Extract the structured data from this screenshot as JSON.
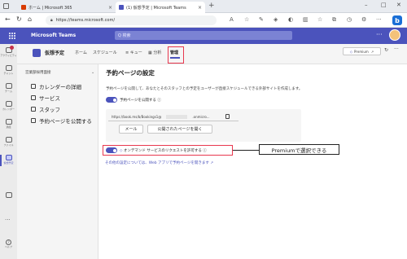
{
  "browser": {
    "tabs": [
      {
        "label": "ホーム | Microsoft 365"
      },
      {
        "label": "(1) 仮想予定 | Microsoft Teams"
      }
    ],
    "url": "https://teams.microsoft.com/",
    "window_controls": {
      "minimize": "–",
      "maximize": "□",
      "close": "✕"
    },
    "profile_initial": "b"
  },
  "teams": {
    "app_name": "Microsoft Teams",
    "search_placeholder": "Q 検索",
    "more": "···"
  },
  "rail": {
    "items": [
      {
        "label": "アクティビティ"
      },
      {
        "label": "チャット"
      },
      {
        "label": "チーム"
      },
      {
        "label": "カレンダー"
      },
      {
        "label": "通話"
      },
      {
        "label": "ファイル"
      },
      {
        "label": "仮想予定"
      }
    ],
    "active_index": 6,
    "more": "···",
    "help_label": "ヘルプ"
  },
  "app_header": {
    "title": "仮想予定",
    "tabs": [
      "ホーム",
      "スケジュール",
      "キュー",
      "分析",
      "管理"
    ],
    "active_tab": "管理",
    "premium_label": "Premium",
    "more": "···"
  },
  "left_nav": {
    "header": "営業部採用面接",
    "items": [
      {
        "label": "カレンダーの詳細",
        "icon": "calendar-icon"
      },
      {
        "label": "サービス",
        "icon": "service-icon"
      },
      {
        "label": "スタッフ",
        "icon": "people-icon"
      },
      {
        "label": "予約ページを公開する",
        "icon": "publish-icon"
      }
    ]
  },
  "main": {
    "title": "予約ページの設定",
    "description": "予約ページを公開して、あなたとそのスタッフとの予定をユーザーが直接スケジュールできる外部サイトを作成します。",
    "publish_toggle_label": "予約ページを公開する",
    "publish_toggle_on": true,
    "booking_url_prefix": "https://book.ms/b/Bookings1@",
    "booking_url_suffix": ".onmicro...",
    "mail_button": "メール",
    "open_page_button": "公開されたページを開く",
    "ondemand_toggle_label": "オンデマンド サービスのリクエストを許可する",
    "ondemand_toggle_on": true,
    "other_settings_prefix": "その他の設定については、",
    "other_settings_link": "Web アプリで予約ページを開きます"
  },
  "annotation": {
    "callout_text": "Premiumで選択できる",
    "highlight_color": "#e8384f"
  },
  "colors": {
    "teams_purple": "#4b53bc",
    "annotation_red": "#e8384f"
  }
}
